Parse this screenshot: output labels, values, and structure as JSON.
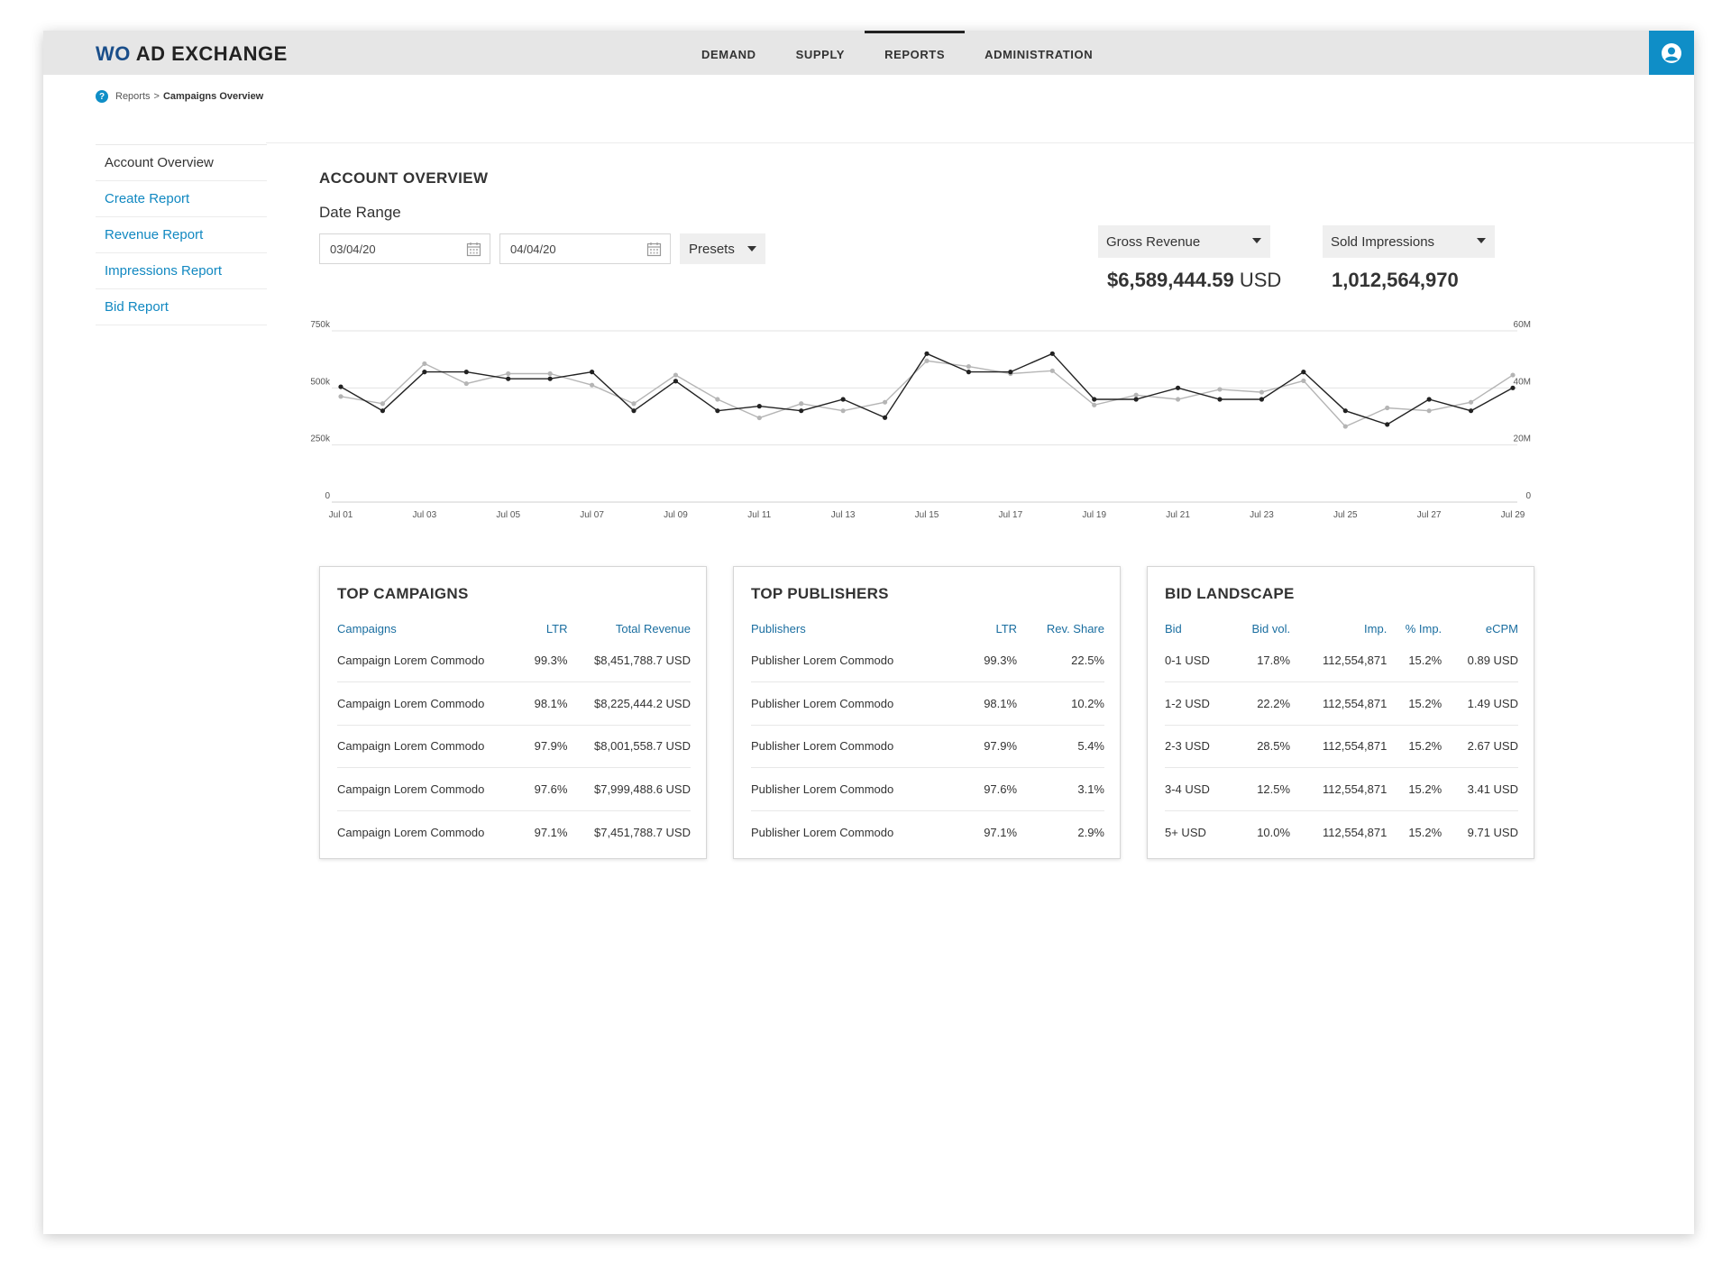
{
  "brand": {
    "prefix": "WO",
    "name": "AD EXCHANGE"
  },
  "nav": {
    "items": [
      {
        "label": "DEMAND"
      },
      {
        "label": "SUPPLY"
      },
      {
        "label": "REPORTS",
        "active": true
      },
      {
        "label": "ADMINISTRATION"
      }
    ]
  },
  "user_icon": "user-circle-icon",
  "breadcrumb": {
    "parent": "Reports",
    "separator": ">",
    "current": "Campaigns Overview"
  },
  "sidebar": {
    "items": [
      {
        "label": "Account Overview",
        "active": true
      },
      {
        "label": "Create Report"
      },
      {
        "label": "Revenue Report"
      },
      {
        "label": "Impressions Report"
      },
      {
        "label": "Bid Report"
      }
    ]
  },
  "overview": {
    "title": "ACCOUNT OVERVIEW",
    "date_range_label": "Date Range",
    "start_date": "03/04/20",
    "end_date": "04/04/20",
    "presets_label": "Presets"
  },
  "metrics": {
    "left": {
      "label": "Gross Revenue",
      "value": "$6,589,444.59",
      "unit": "USD"
    },
    "right": {
      "label": "Sold Impressions",
      "value": "1,012,564,970"
    }
  },
  "colors": {
    "accent": "#0f8ec7",
    "series_primary": "#222222",
    "series_secondary": "#b5b5b5",
    "header_bg": "#e6e6e6"
  },
  "chart_data": {
    "type": "line",
    "x": [
      "Jul 01",
      "Jul 02",
      "Jul 03",
      "Jul 04",
      "Jul 05",
      "Jul 06",
      "Jul 07",
      "Jul 08",
      "Jul 09",
      "Jul 10",
      "Jul 11",
      "Jul 12",
      "Jul 13",
      "Jul 14",
      "Jul 15",
      "Jul 16",
      "Jul 17",
      "Jul 18",
      "Jul 19",
      "Jul 20",
      "Jul 21",
      "Jul 22",
      "Jul 23",
      "Jul 24",
      "Jul 25",
      "Jul 26",
      "Jul 27",
      "Jul 28",
      "Jul 29"
    ],
    "x_tick_labels": [
      "Jul 01",
      "Jul 03",
      "Jul 05",
      "Jul 07",
      "Jul 09",
      "Jul 11",
      "Jul 13",
      "Jul 15",
      "Jul 17",
      "Jul 19",
      "Jul 21",
      "Jul 23",
      "Jul 25",
      "Jul 27",
      "Jul 29"
    ],
    "y_left_ticks": [
      "0",
      "250k",
      "500k",
      "750k"
    ],
    "y_left_range": [
      0,
      750000
    ],
    "y_right_ticks": [
      "0",
      "20M",
      "40M",
      "60M"
    ],
    "y_right_range": [
      0,
      60000000
    ],
    "grid": true,
    "series": [
      {
        "axis": "left",
        "values": [
          505000,
          400000,
          570000,
          570000,
          540000,
          540000,
          570000,
          400000,
          530000,
          400000,
          420000,
          400000,
          450000,
          370000,
          650000,
          570000,
          570000,
          650000,
          450000,
          450000,
          500000,
          450000,
          450000,
          570000,
          400000,
          340000,
          450000,
          400000,
          500000
        ]
      },
      {
        "axis": "right",
        "values": [
          37000000,
          34500000,
          48500000,
          41500000,
          45000000,
          45000000,
          41000000,
          34500000,
          44500000,
          36000000,
          29500000,
          34500000,
          32000000,
          35000000,
          49500000,
          47500000,
          45000000,
          46000000,
          34000000,
          37500000,
          36000000,
          39500000,
          38500000,
          42500000,
          26500000,
          33000000,
          32000000,
          35000000,
          44500000
        ]
      }
    ]
  },
  "top_campaigns": {
    "title": "TOP CAMPAIGNS",
    "headers": [
      "Campaigns",
      "LTR",
      "Total Revenue"
    ],
    "rows": [
      [
        "Campaign Lorem Commodo",
        "99.3%",
        "$8,451,788.7 USD"
      ],
      [
        "Campaign Lorem Commodo",
        "98.1%",
        "$8,225,444.2 USD"
      ],
      [
        "Campaign Lorem Commodo",
        "97.9%",
        "$8,001,558.7 USD"
      ],
      [
        "Campaign Lorem Commodo",
        "97.6%",
        "$7,999,488.6 USD"
      ],
      [
        "Campaign Lorem Commodo",
        "97.1%",
        "$7,451,788.7 USD"
      ]
    ]
  },
  "top_publishers": {
    "title": "TOP PUBLISHERS",
    "headers": [
      "Publishers",
      "LTR",
      "Rev. Share"
    ],
    "rows": [
      [
        "Publisher Lorem Commodo",
        "99.3%",
        "22.5%"
      ],
      [
        "Publisher Lorem Commodo",
        "98.1%",
        "10.2%"
      ],
      [
        "Publisher Lorem Commodo",
        "97.9%",
        "5.4%"
      ],
      [
        "Publisher Lorem Commodo",
        "97.6%",
        "3.1%"
      ],
      [
        "Publisher Lorem Commodo",
        "97.1%",
        "2.9%"
      ]
    ]
  },
  "bid_landscape": {
    "title": "BID LANDSCAPE",
    "headers": [
      "Bid",
      "Bid vol.",
      "Imp.",
      "% Imp.",
      "eCPM"
    ],
    "rows": [
      [
        "0-1 USD",
        "17.8%",
        "112,554,871",
        "15.2%",
        "0.89 USD"
      ],
      [
        "1-2 USD",
        "22.2%",
        "112,554,871",
        "15.2%",
        "1.49 USD"
      ],
      [
        "2-3 USD",
        "28.5%",
        "112,554,871",
        "15.2%",
        "2.67 USD"
      ],
      [
        "3-4 USD",
        "12.5%",
        "112,554,871",
        "15.2%",
        "3.41 USD"
      ],
      [
        "5+ USD",
        "10.0%",
        "112,554,871",
        "15.2%",
        "9.71 USD"
      ]
    ]
  }
}
